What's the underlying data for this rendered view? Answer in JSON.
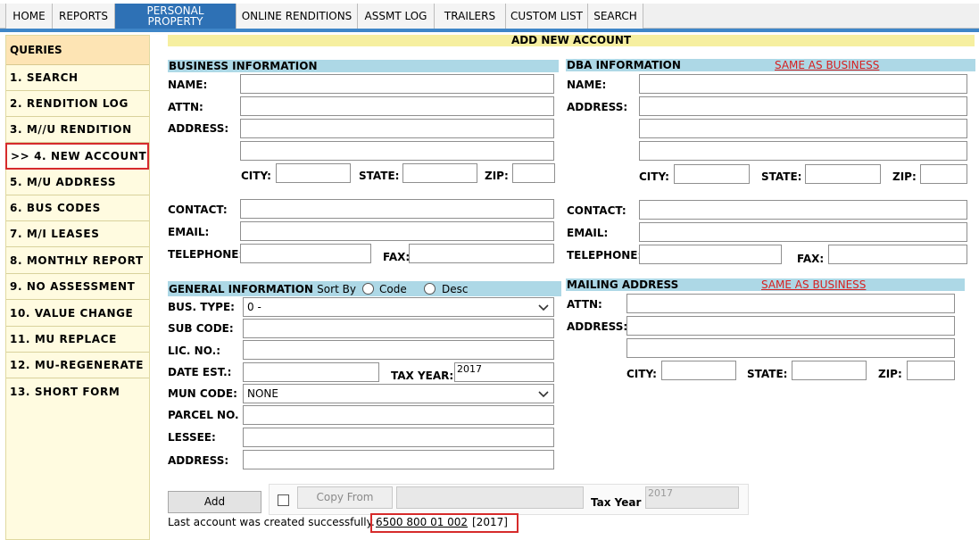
{
  "nav": {
    "tabs": [
      "HOME",
      "REPORTS",
      "PERSONAL PROPERTY",
      "ONLINE RENDITIONS",
      "ASSMT LOG",
      "TRAILERS",
      "CUSTOM LIST",
      "SEARCH"
    ],
    "active_line1": "PERSONAL",
    "active_line2": "PROPERTY"
  },
  "sidebar": {
    "heading": "QUERIES",
    "items": [
      "1. SEARCH",
      "2. RENDITION LOG",
      "3. M//U RENDITION",
      ">> 4. NEW ACCOUNT",
      "5. M/U ADDRESS",
      "6. BUS CODES",
      "7. M/I LEASES",
      "8. MONTHLY REPORT",
      "9. NO ASSESSMENT",
      "10. VALUE CHANGE",
      "11. MU REPLACE",
      "12. MU-REGENERATE",
      "13. SHORT FORM"
    ]
  },
  "page_title": "ADD NEW ACCOUNT",
  "business": {
    "heading": "BUSINESS INFORMATION",
    "name": "NAME:",
    "attn": "ATTN:",
    "address": "ADDRESS:",
    "city": "CITY:",
    "state": "STATE:",
    "zip": "ZIP:",
    "contact": "CONTACT:",
    "email": "EMAIL:",
    "telephone": "TELEPHONE:",
    "fax": "FAX:"
  },
  "dba": {
    "heading": "DBA INFORMATION",
    "same_link": "SAME AS BUSINESS",
    "name": "NAME:",
    "address": "ADDRESS:",
    "city": "CITY:",
    "state": "STATE:",
    "zip": "ZIP:",
    "contact": "CONTACT:",
    "email": "EMAIL:",
    "telephone": "TELEPHONE:",
    "fax": "FAX:"
  },
  "general": {
    "heading": "GENERAL INFORMATION",
    "sort_by": "Sort By",
    "code": "Code",
    "desc": "Desc",
    "bus_type": "BUS. TYPE:",
    "bus_type_value": "0 -",
    "sub_code": "SUB CODE:",
    "lic_no": "LIC. NO.:",
    "date_est": "DATE EST.:",
    "tax_year_label": "TAX YEAR:",
    "tax_year_value": "2017",
    "mun_code": "MUN CODE:",
    "mun_code_value": "NONE",
    "parcel_no": "PARCEL NO.",
    "lessee": "LESSEE:",
    "address": "ADDRESS:"
  },
  "mailing": {
    "heading": "MAILING ADDRESS",
    "same_link": "SAME AS BUSINESS",
    "attn": "ATTN:",
    "address": "ADDRESS:",
    "city": "CITY:",
    "state": "STATE:",
    "zip": "ZIP:"
  },
  "actions": {
    "add": "Add",
    "copy_from": "Copy From",
    "tax_year_label": "Tax Year",
    "tax_year_value": "2017"
  },
  "status": {
    "message": "Last account was created successfully.",
    "account_link": "6500 800 01 002",
    "year": "[2017]"
  },
  "colors": {
    "nav_active": "#2e71b5",
    "section_bar": "#add8e6",
    "banner": "#f6efa0",
    "sidebar_bg": "#fffbe0",
    "highlight": "#d62b2b"
  }
}
